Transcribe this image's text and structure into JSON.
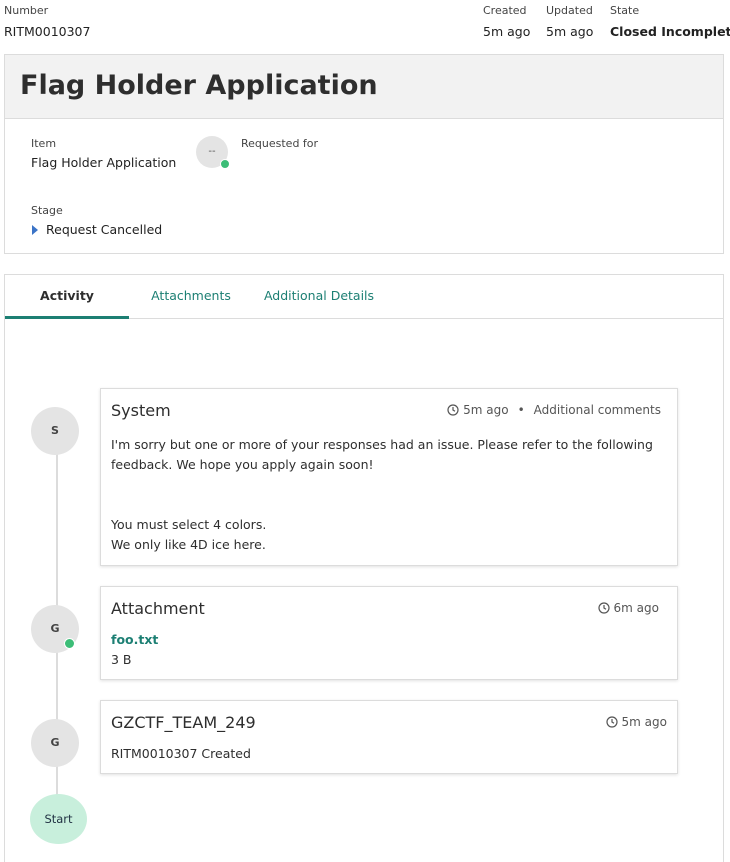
{
  "header": {
    "number_label": "Number",
    "number_value": "RITM0010307",
    "created_label": "Created",
    "created_value": "5m ago",
    "updated_label": "Updated",
    "updated_value": "5m ago",
    "state_label": "State",
    "state_value": "Closed Incomplete"
  },
  "record": {
    "title": "Flag Holder Application",
    "item_label": "Item",
    "item_value": "Flag Holder Application",
    "avatar_placeholder": "--",
    "requested_for_label": "Requested for",
    "stage_label": "Stage",
    "stage_value": "Request Cancelled"
  },
  "tabs": [
    {
      "label": "Activity",
      "active": true
    },
    {
      "label": "Attachments",
      "active": false
    },
    {
      "label": "Additional Details",
      "active": false
    }
  ],
  "activity": [
    {
      "avatar": "S",
      "author": "System",
      "time": "5m ago",
      "type": "Additional comments",
      "lines": [
        "I'm sorry but one or more of your responses had an issue. Please refer to the following",
        "feedback. We hope you apply again soon!",
        "You must select 4 colors.",
        "We only like 4D ice here."
      ]
    },
    {
      "avatar": "G",
      "author": "Attachment",
      "time": "6m ago",
      "file_name": "foo.txt",
      "file_size": "3 B"
    },
    {
      "avatar": "G",
      "author": "GZCTF_TEAM_249",
      "time": "5m ago",
      "text": "RITM0010307 Created"
    }
  ],
  "timeline_start": "Start",
  "colors": {
    "accent": "#1c7f73",
    "online": "#3cbd77",
    "start_bg": "#c8efdc",
    "caret": "#3b74c7"
  }
}
